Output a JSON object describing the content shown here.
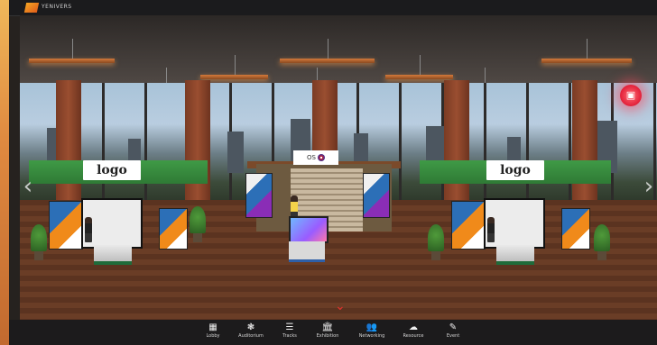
{
  "app": {
    "brand_text": "YENIVERS"
  },
  "scene": {
    "booth_left_logo": "logo",
    "booth_right_logo": "logo",
    "stage_sign": "OS"
  },
  "controls": {
    "prev_arrow": "‹",
    "next_arrow": "›",
    "calendar_icon": "calendar-icon",
    "down_icon": "chevron-down-icon"
  },
  "bottom_nav": [
    {
      "label": "Lobby",
      "icon": "grid-icon",
      "glyph": "▦"
    },
    {
      "label": "Auditorium",
      "icon": "auditorium-icon",
      "glyph": "❃"
    },
    {
      "label": "Tracks",
      "icon": "list-icon",
      "glyph": "☰"
    },
    {
      "label": "Exhibition",
      "icon": "exhibition-icon",
      "glyph": "🏛"
    },
    {
      "label": "Networking",
      "icon": "people-icon",
      "glyph": "👥"
    },
    {
      "label": "Resource",
      "icon": "cloud-download-icon",
      "glyph": "☁"
    },
    {
      "label": "Event",
      "icon": "pen-icon",
      "glyph": "✎"
    }
  ],
  "colors": {
    "accent": "#e21f38",
    "booth_green": "#3f9a46",
    "floor": "#6a3d26",
    "bar": "#1c1b1c"
  }
}
